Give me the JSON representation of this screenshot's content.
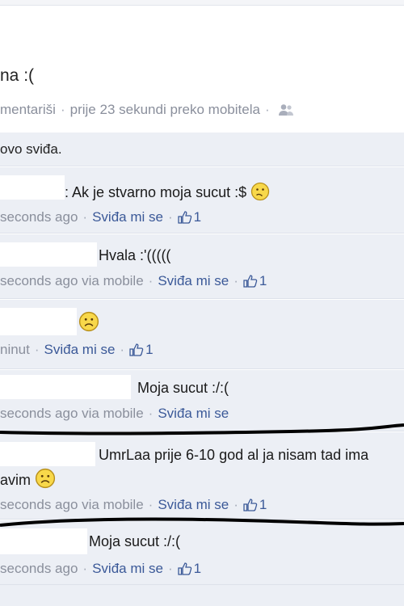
{
  "post": {
    "text": "na :(",
    "meta_comment": "mentariši",
    "meta_time": "prije 23 sekundi preko mobitela",
    "people_icon": "people-icon"
  },
  "likes": {
    "text": "ovo sviđa."
  },
  "comments": [
    {
      "text": ": Ak je stvarno moja sucut :$",
      "time": "seconds ago",
      "like": "Sviđa mi se",
      "count": "1",
      "emoticon": "confused-emoticon"
    },
    {
      "text": "Hvala :'(((((",
      "time": "seconds ago via mobile",
      "like": "Sviđa mi se",
      "count": "1"
    },
    {
      "text": "",
      "time": "ninut",
      "like": "Sviđa mi se",
      "count": "1",
      "emoticon": "frown-emoticon"
    },
    {
      "text": "Moja sucut :/:(",
      "time": "seconds ago via mobile",
      "like": "Sviđa mi se",
      "count": ""
    },
    {
      "text": "UmrLaa prije 6-10 god al ja nisam tad ima",
      "text2": "avim",
      "time": "seconds ago via mobile",
      "like": "Sviđa mi se",
      "count": "1",
      "emoticon": "frown-emoticon"
    },
    {
      "text": "Moja sucut :/:(",
      "time": "seconds ago",
      "like": "Sviđa mi se",
      "count": "1"
    }
  ]
}
